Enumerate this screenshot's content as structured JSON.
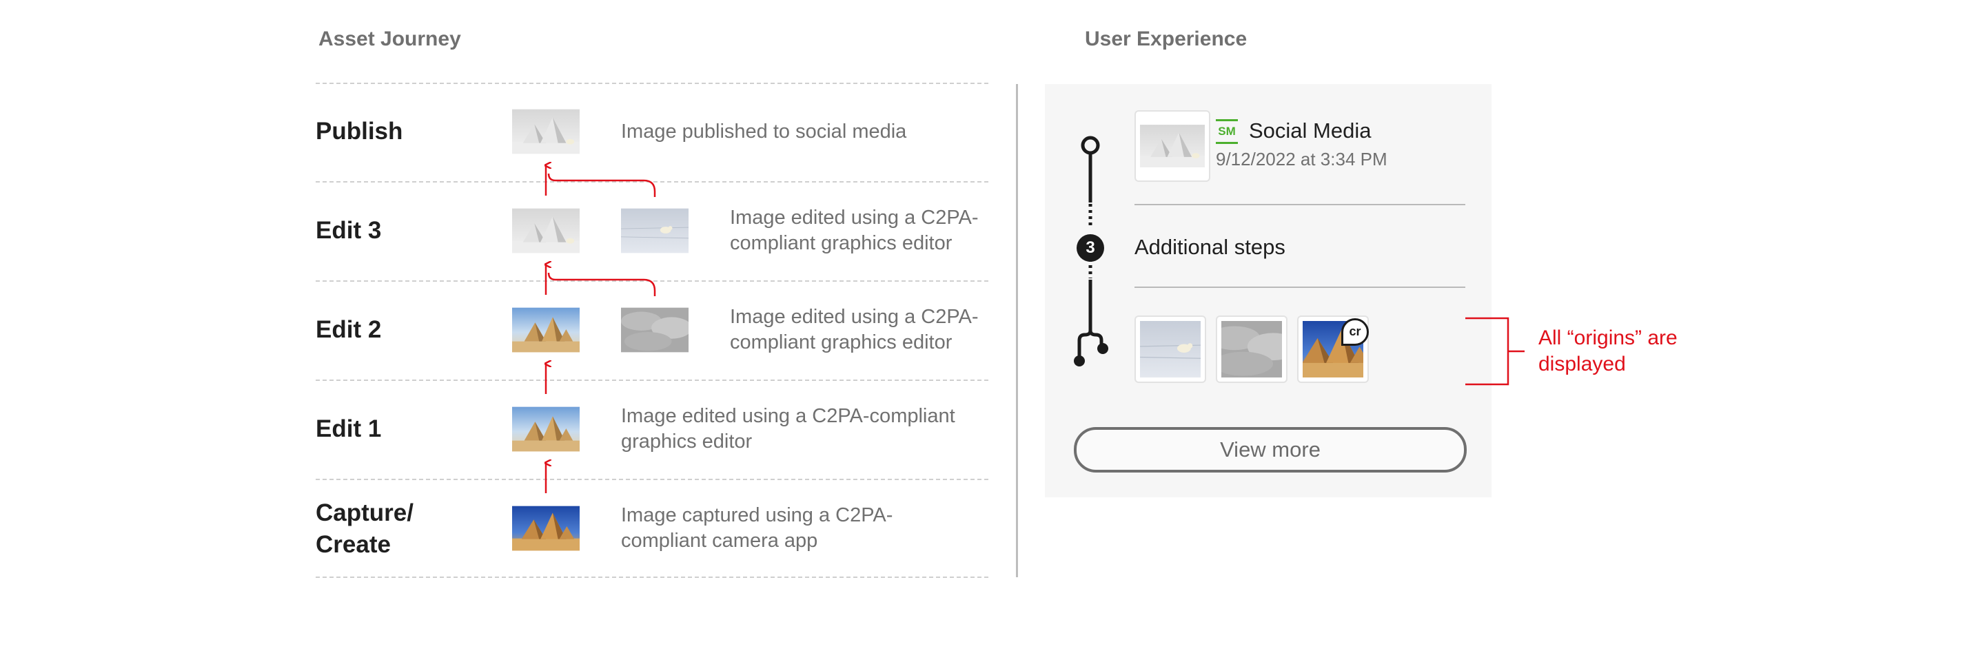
{
  "asset_journey": {
    "title": "Asset Journey",
    "steps": [
      {
        "label": "Publish",
        "description": "Image published to social media"
      },
      {
        "label": "Edit 3",
        "description": "Image edited using a C2PA-compliant graphics editor"
      },
      {
        "label": "Edit 2",
        "description": "Image edited using a C2PA-compliant graphics editor"
      },
      {
        "label": "Edit 1",
        "description": "Image edited using a C2PA-compliant graphics editor"
      },
      {
        "label": "Capture/ Create",
        "description": "Image captured using a C2PA-compliant camera app"
      }
    ]
  },
  "user_experience": {
    "title": "User Experience",
    "latest": {
      "badge": "SM",
      "name": "Social Media",
      "timestamp": "9/12/2022 at 3:34 PM"
    },
    "additional_steps": {
      "count": "3",
      "label": "Additional steps"
    },
    "origins_badge": "cr",
    "view_more": "View more"
  },
  "callout": {
    "text": "All “origins” are displayed"
  },
  "colors": {
    "accent_red": "#e0101a",
    "badge_green": "#4caf2e"
  },
  "icons": [
    "arrow-up-icon",
    "branch-timeline-icon",
    "content-credentials-icon"
  ]
}
